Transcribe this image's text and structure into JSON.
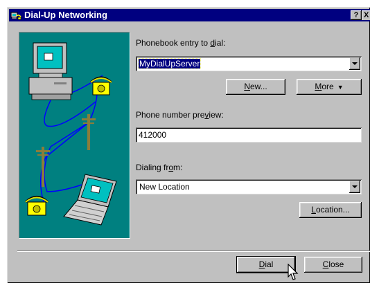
{
  "window": {
    "title": "Dial-Up Networking",
    "help_label": "?",
    "close_label": "X"
  },
  "phonebook": {
    "label_pre": "Phonebook entry to ",
    "label_key": "d",
    "label_post": "ial:",
    "selected": "MyDialUpServer"
  },
  "buttons": {
    "new_key": "N",
    "new_rest": "ew...",
    "more_key": "M",
    "more_rest": "ore",
    "location_key": "L",
    "location_rest": "ocation...",
    "dial_key": "D",
    "dial_rest": "ial",
    "close_key": "C",
    "close_rest": "lose"
  },
  "preview": {
    "label_pre": "Phone number pre",
    "label_key": "v",
    "label_post": "iew:",
    "value": "412000"
  },
  "dialing_from": {
    "label_pre": "Dialing fr",
    "label_key": "o",
    "label_post": "m:",
    "selected": "New Location"
  },
  "colors": {
    "titlebar": "#000080",
    "illustration_bg": "#008080",
    "face": "#c0c0c0"
  }
}
